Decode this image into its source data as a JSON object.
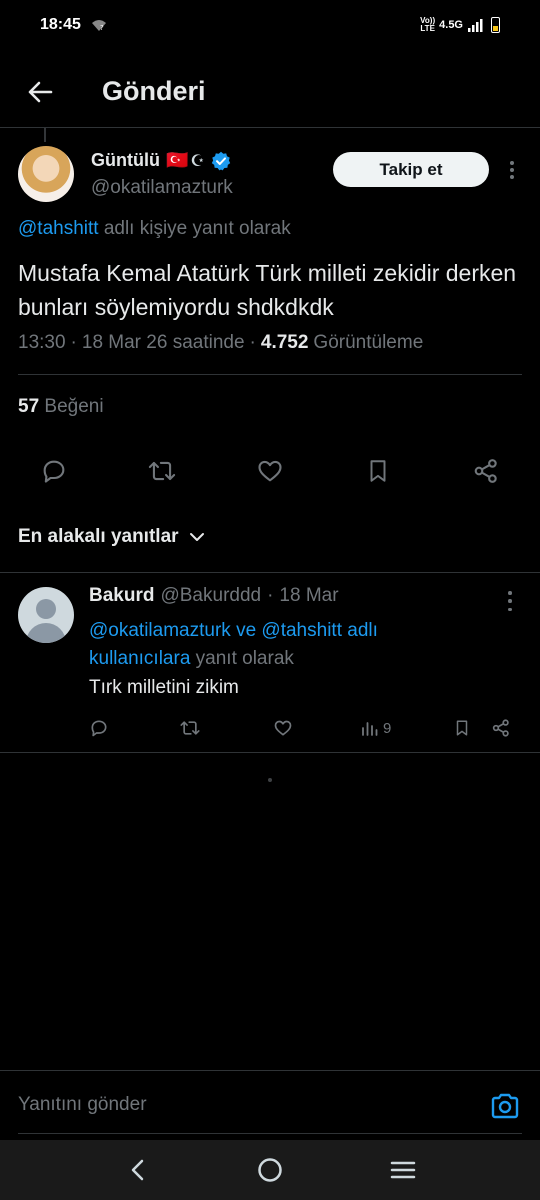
{
  "status_bar": {
    "time": "18:45",
    "volte": "Vo))\nLTE",
    "network": "4.5G",
    "battery_level": 0.35,
    "battery_color": "#f5c518"
  },
  "header": {
    "back_icon": "arrow-left-icon",
    "title": "Gönderi"
  },
  "post": {
    "author_name": "Güntülü",
    "author_flags": "🇹🇷",
    "author_star": "☪",
    "author_handle": "@okatilamazturk",
    "verified": true,
    "follow_label": "Takip et",
    "reply_to_mention": "@tahshitt",
    "reply_to_suffix": "adlı kişiye yanıt olarak",
    "text": "Mustafa Kemal Atatürk Türk milleti zekidir derken bunları söylemiyordu shdkdkdk",
    "time": "13:30",
    "dot1": "·",
    "date": "18 Mar 26 saatinde",
    "dot2": "·",
    "views_count": "4.752",
    "views_label": "Görüntüleme",
    "likes_count": "57",
    "likes_label": "Beğeni"
  },
  "sort_label": "En alakalı yanıtlar",
  "reply": {
    "name": "Bakurd",
    "handle": "@Bakurddd",
    "dot": "·",
    "date": "18 Mar",
    "reply_to_line1_mention1": "@okatilamazturk",
    "reply_to_line1_and": "ve",
    "reply_to_line1_mention2": "@tahshitt adlı",
    "reply_to_line2_mention": "kullanıcılara",
    "reply_to_line2_suffix": "yanıt olarak",
    "text": "Tırk milletini zikim",
    "views_count": "9"
  },
  "compose": {
    "placeholder": "Yanıtını gönder"
  },
  "colors": {
    "background": "#000000",
    "accent": "#1d9bf0",
    "muted": "#71767b",
    "text": "#e7e9ea",
    "divider": "#2f3336"
  }
}
